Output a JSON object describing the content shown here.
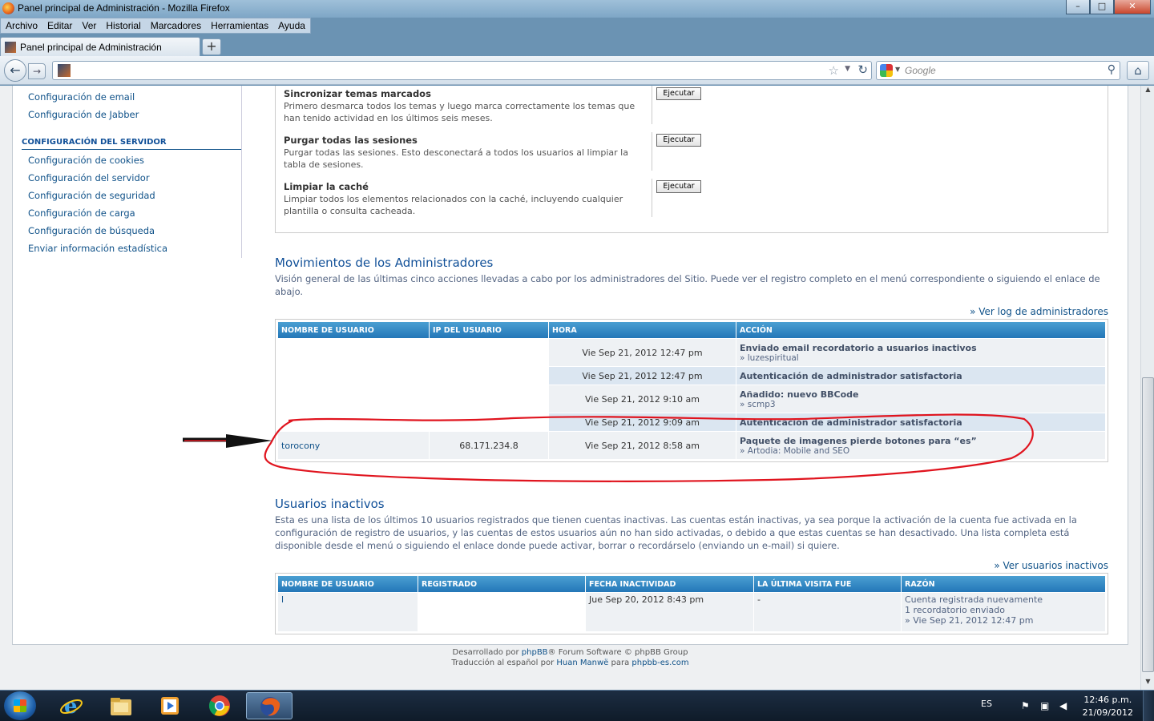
{
  "window": {
    "title": "Panel principal de Administración - Mozilla Firefox",
    "menu": [
      "Archivo",
      "Editar",
      "Ver",
      "Historial",
      "Marcadores",
      "Herramientas",
      "Ayuda"
    ],
    "tab_title": "Panel principal de Administración",
    "search_placeholder": "Google",
    "controls": {
      "minimize": "–",
      "maximize": "□",
      "close": "✕"
    }
  },
  "sidebar": {
    "top_links": [
      "Configuración de email",
      "Configuración de Jabber"
    ],
    "server_header": "CONFIGURACIÓN DEL SERVIDOR",
    "server_links": [
      "Configuración de cookies",
      "Configuración del servidor",
      "Configuración de seguridad",
      "Configuración de carga",
      "Configuración de búsqueda",
      "Enviar información estadística"
    ]
  },
  "tools": [
    {
      "title": "Sincronizar temas marcados",
      "desc": "Primero desmarca todos los temas y luego marca correctamente los temas que han tenido actividad en los últimos seis meses.",
      "button": "Ejecutar"
    },
    {
      "title": "Purgar todas las sesiones",
      "desc": "Purgar todas las sesiones. Esto desconectará a todos los usuarios al limpiar la tabla de sesiones.",
      "button": "Ejecutar"
    },
    {
      "title": "Limpiar la caché",
      "desc": "Limpiar todos los elementos relacionados con la caché, incluyendo cualquier plantilla o consulta cacheada.",
      "button": "Ejecutar"
    }
  ],
  "admin_log": {
    "title": "Movimientos de los Administradores",
    "desc": "Visión general de las últimas cinco acciones llevadas a cabo por los administradores del Sitio. Puede ver el registro completo en el menú correspondiente o siguiendo el enlace de abajo.",
    "link": "» Ver log de administradores",
    "columns": [
      "NOMBRE DE USUARIO",
      "IP DEL USUARIO",
      "HORA",
      "ACCIÓN"
    ],
    "rows": [
      {
        "user": "",
        "ip": "",
        "time": "Vie Sep 21, 2012 12:47 pm",
        "action": "Enviado email recordatorio a usuarios inactivos",
        "detail": "» luzespiritual"
      },
      {
        "user": "",
        "ip": "",
        "time": "Vie Sep 21, 2012 12:47 pm",
        "action": "Autenticación de administrador satisfactoria",
        "detail": ""
      },
      {
        "user": "",
        "ip": "",
        "time": "Vie Sep 21, 2012 9:10 am",
        "action": "Añadido: nuevo BBCode",
        "detail": "» scmp3"
      },
      {
        "user": "",
        "ip": "",
        "time": "Vie Sep 21, 2012 9:09 am",
        "action": "Autenticación de administrador satisfactoria",
        "detail": ""
      },
      {
        "user": "torocony",
        "ip": "68.171.234.8",
        "time": "Vie Sep 21, 2012 8:58 am",
        "action": "Paquete de imagenes pierde botones para “es”",
        "detail": "» Artodia: Mobile and SEO"
      }
    ]
  },
  "inactive": {
    "title": "Usuarios inactivos",
    "desc": "Esta es una lista de los últimos 10 usuarios registrados que tienen cuentas inactivas. Las cuentas están inactivas, ya sea porque la activación de la cuenta fue activada en la configuración de registro de usuarios, y las cuentas de estos usuarios aún no han sido activadas, o debido a que estas cuentas se han desactivado. Una lista completa está disponible desde el menú o siguiendo el enlace donde puede activar, borrar o recordárselo (enviando un e-mail) si quiere.",
    "link": "» Ver usuarios inactivos",
    "columns": [
      "NOMBRE DE USUARIO",
      "REGISTRADO",
      "FECHA INACTIVIDAD",
      "LA ÚLTIMA VISITA FUE",
      "RAZÓN"
    ],
    "rows": [
      {
        "user": "l",
        "registered": "",
        "inactive_date": "Jue Sep 20, 2012 8:43 pm",
        "last_visit": "-",
        "reason": [
          "Cuenta registrada nuevamente",
          "1 recordatorio enviado",
          "» Vie Sep 21, 2012 12:47 pm"
        ]
      }
    ]
  },
  "footer": {
    "line1_pre": "Desarrollado por",
    "line1_brand": "phpBB",
    "line1_post": "® Forum Software © phpBB Group",
    "line2_pre": "Traducción al español por",
    "line2_name": "Huan Manwë",
    "line2_mid": "para",
    "line2_site": "phpbb-es.com"
  },
  "taskbar": {
    "lang": "ES",
    "time": "12:46 p.m.",
    "date": "21/09/2012"
  },
  "colors": {
    "annotation": "#e0141e",
    "header_blue": "#2477b8",
    "link": "#105289"
  }
}
